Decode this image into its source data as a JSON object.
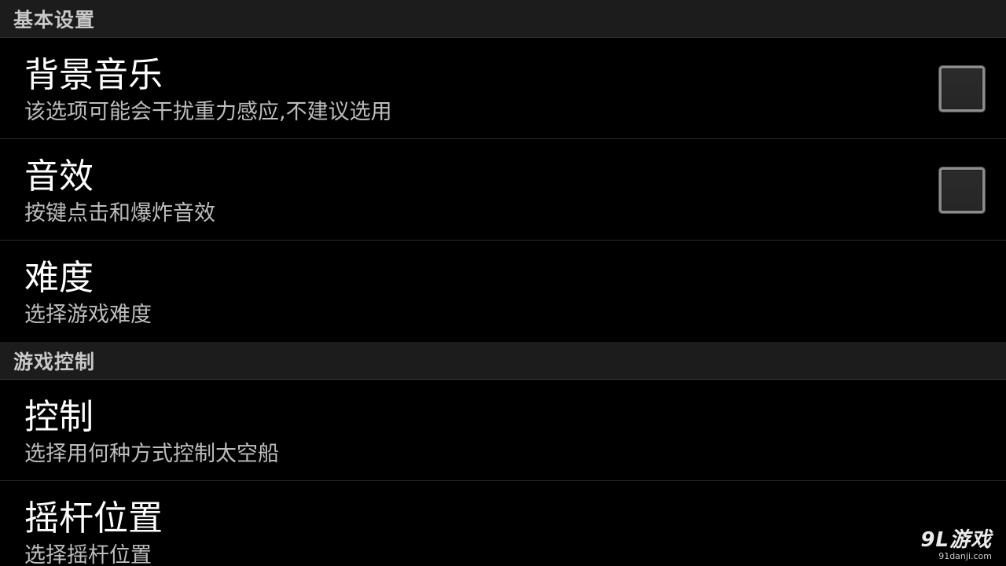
{
  "sections": {
    "basic": {
      "header": "基本设置",
      "items": [
        {
          "title": "背景音乐",
          "summary": "该选项可能会干扰重力感应,不建议选用",
          "checked": false
        },
        {
          "title": "音效",
          "summary": "按键点击和爆炸音效",
          "checked": false
        },
        {
          "title": "难度",
          "summary": "选择游戏难度"
        }
      ]
    },
    "control": {
      "header": "游戏控制",
      "items": [
        {
          "title": "控制",
          "summary": "选择用何种方式控制太空船"
        },
        {
          "title": "摇杆位置",
          "summary": "选择摇杆位置"
        }
      ]
    }
  },
  "watermark": {
    "logo": "9L游戏",
    "url": "91danji.com"
  }
}
